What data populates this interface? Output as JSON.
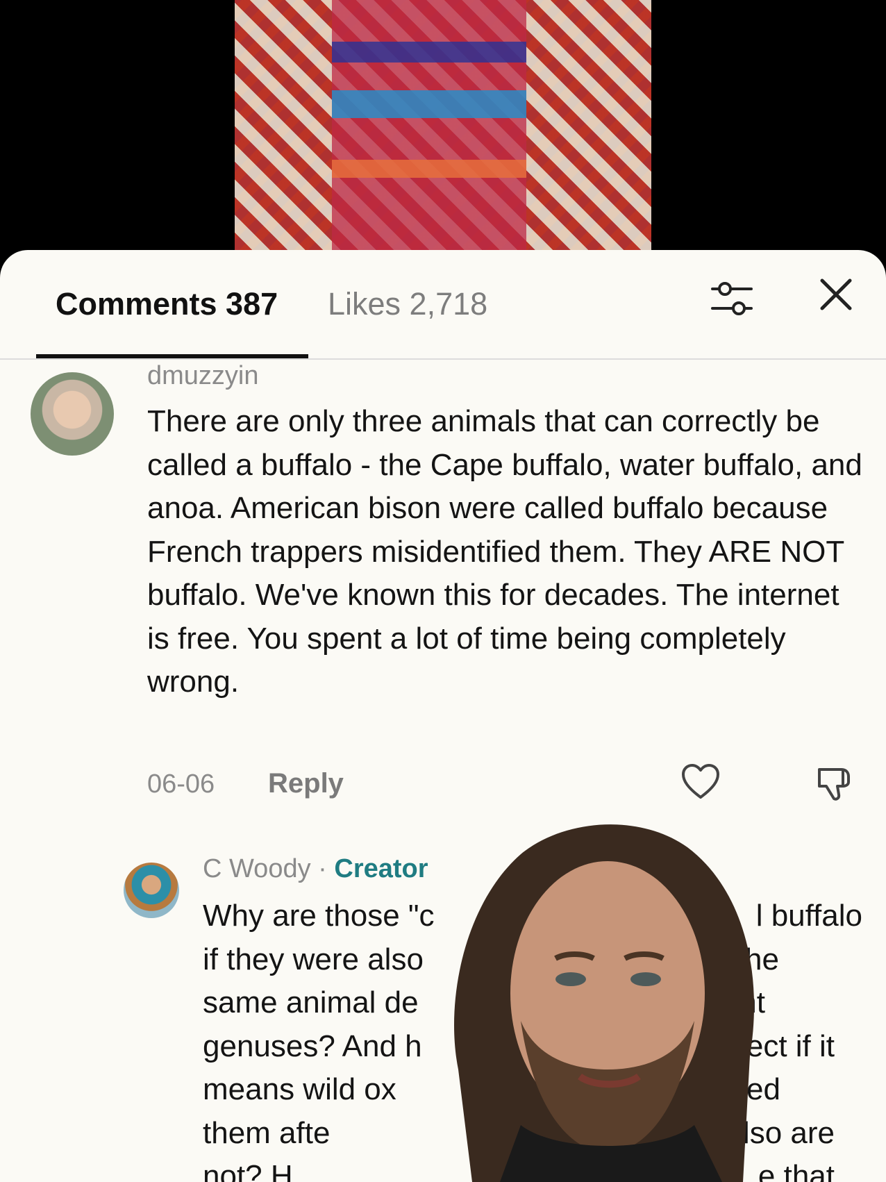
{
  "tabs": {
    "comments_label": "Comments 387",
    "likes_label": "Likes 2,718"
  },
  "comments": [
    {
      "username": "dmuzzyin",
      "text": "There are only three animals that can correctly be called a buffalo - the Cape buffalo, water buffalo, and anoa. American bison were called buffalo because French trappers misidentified them. They ARE NOT buffalo. We've known this for decades. The internet is free. You spent a lot of time being completely wrong.",
      "date": "06-06",
      "reply_label": "Reply"
    },
    {
      "username": "C Woody",
      "separator": " · ",
      "badge": "Creator",
      "lines": [
        "Why are those \"c",
        "l buffalo",
        "if they were also",
        "s the",
        "same animal de",
        "rent",
        "genuses? And h",
        "ect if it",
        "means wild ox",
        "amed",
        "them afte",
        "also are",
        "not? H",
        "e that"
      ]
    }
  ],
  "icons": {
    "filter": "filter-sliders-icon",
    "close": "close-icon",
    "heart": "heart-icon",
    "dislike": "thumbs-down-icon"
  },
  "colors": {
    "sheet_bg": "#fbfaf5",
    "creator_accent": "#1f7c82",
    "muted_text": "#8a8a8a"
  }
}
